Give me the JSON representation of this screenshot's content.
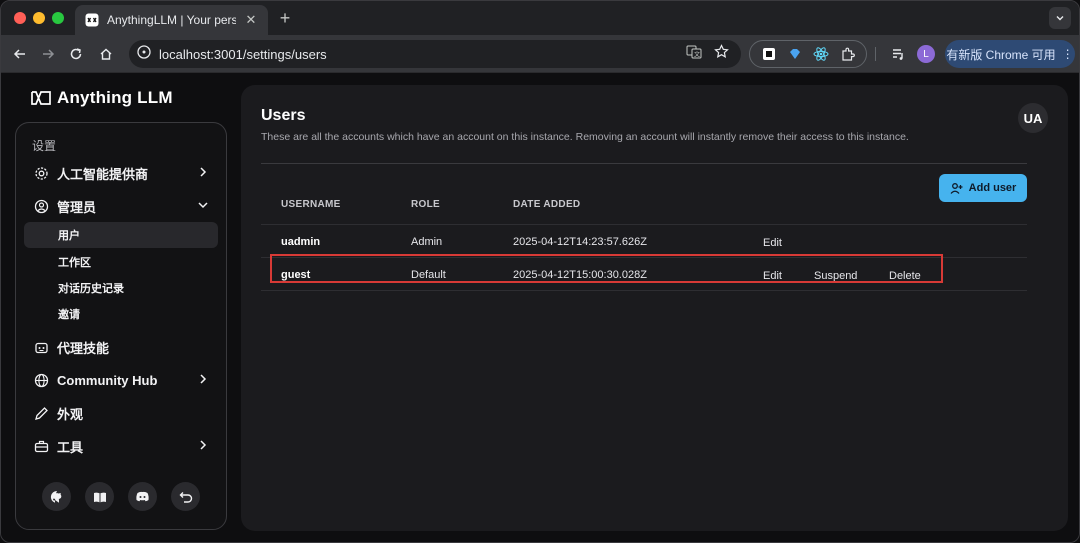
{
  "browser": {
    "tab_title": "AnythingLLM | Your personal",
    "url": "localhost:3001/settings/users",
    "profile_initial": "L",
    "update_label": "有新版 Chrome 可用"
  },
  "app": {
    "brand": "Anything LLM"
  },
  "sidebar": {
    "heading": "设置",
    "items": [
      {
        "label": "人工智能提供商"
      },
      {
        "label": "管理员"
      },
      {
        "label": "代理技能"
      },
      {
        "label": "Community Hub"
      },
      {
        "label": "外观"
      },
      {
        "label": "工具"
      }
    ],
    "admin_sub": [
      {
        "label": "用户"
      },
      {
        "label": "工作区"
      },
      {
        "label": "对话历史记录"
      },
      {
        "label": "邀请"
      }
    ]
  },
  "main": {
    "title": "Users",
    "description": "These are all the accounts which have an account on this instance. Removing an account will instantly remove their access to this instance.",
    "avatar": "UA",
    "add_user_label": "Add user",
    "columns": [
      "USERNAME",
      "ROLE",
      "DATE ADDED"
    ],
    "rows": [
      {
        "username": "uadmin",
        "role": "Admin",
        "date": "2025-04-12T14:23:57.626Z",
        "actions": [
          "Edit"
        ]
      },
      {
        "username": "guest",
        "role": "Default",
        "date": "2025-04-12T15:00:30.028Z",
        "actions": [
          "Edit",
          "Suspend",
          "Delete"
        ]
      }
    ]
  },
  "colors": {
    "accent": "#46b3ee",
    "highlight": "#d83a36"
  }
}
